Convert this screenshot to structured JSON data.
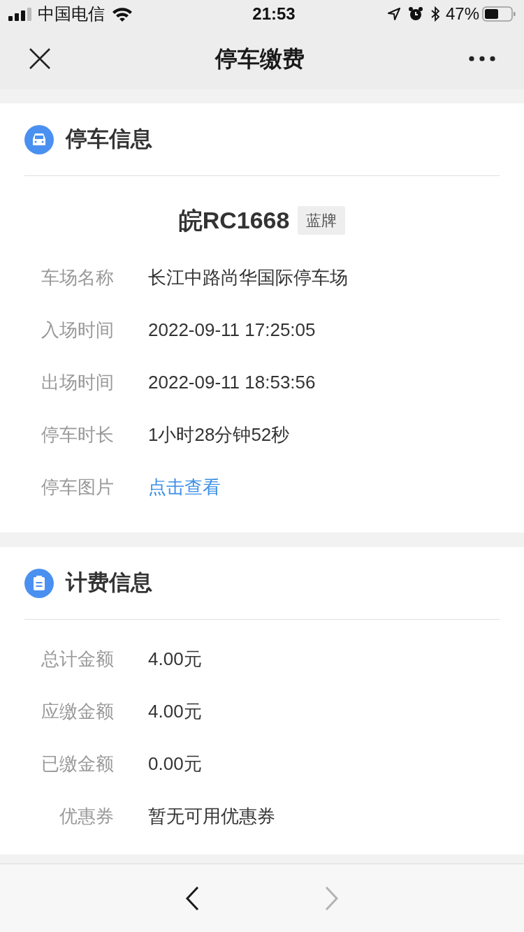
{
  "status_bar": {
    "carrier": "中国电信",
    "time": "21:53",
    "battery": "47%"
  },
  "nav": {
    "title": "停车缴费"
  },
  "parking": {
    "title": "停车信息",
    "plate": "皖RC1668",
    "plate_tag": "蓝牌",
    "rows": [
      {
        "label": "车场名称",
        "value": "长江中路尚华国际停车场",
        "kind": "text"
      },
      {
        "label": "入场时间",
        "value": "2022-09-11 17:25:05",
        "kind": "text"
      },
      {
        "label": "出场时间",
        "value": "2022-09-11 18:53:56",
        "kind": "text"
      },
      {
        "label": "停车时长",
        "value": "1小时28分钟52秒",
        "kind": "text"
      },
      {
        "label": "停车图片",
        "value": "点击查看",
        "kind": "link"
      }
    ]
  },
  "billing": {
    "title": "计费信息",
    "rows": [
      {
        "label": "总计金额",
        "value": "4.00元",
        "kind": "text"
      },
      {
        "label": "应缴金额",
        "value": "4.00元",
        "kind": "text"
      },
      {
        "label": "已缴金额",
        "value": "0.00元",
        "kind": "text"
      },
      {
        "label": "优惠券",
        "value": "暂无可用优惠券",
        "kind": "text"
      }
    ]
  },
  "toolbar": {
    "back_disabled": false,
    "forward_disabled": true
  }
}
